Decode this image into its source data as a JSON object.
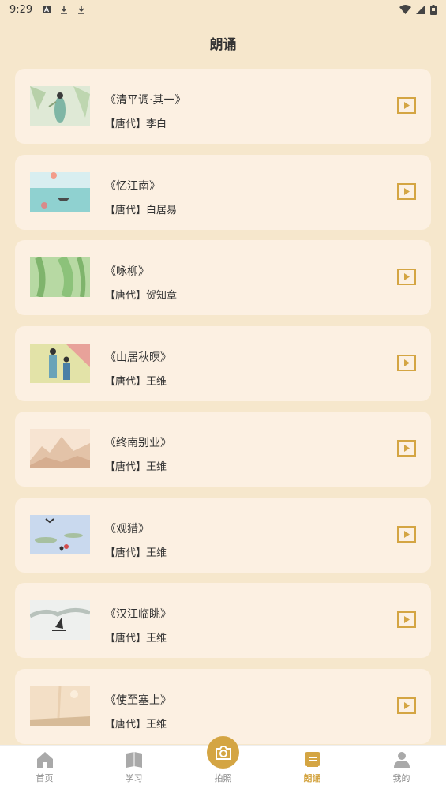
{
  "status_bar": {
    "time": "9:29",
    "icons": [
      "a-icon",
      "download-icon",
      "download-icon"
    ],
    "right_icons": [
      "wifi-icon",
      "signal-icon",
      "battery-icon"
    ]
  },
  "header": {
    "title": "朗诵"
  },
  "poems": [
    {
      "title": "《清平调·其一》",
      "author": "【唐代】李白",
      "thumb": "lady-painting"
    },
    {
      "title": "《忆江南》",
      "author": "【唐代】白居易",
      "thumb": "river-boat-painting"
    },
    {
      "title": "《咏柳》",
      "author": "【唐代】贺知章",
      "thumb": "willow-painting"
    },
    {
      "title": "《山居秋暝》",
      "author": "【唐代】王维",
      "thumb": "figures-painting"
    },
    {
      "title": "《终南别业》",
      "author": "【唐代】王维",
      "thumb": "mountain-painting"
    },
    {
      "title": "《观猎》",
      "author": "【唐代】王维",
      "thumb": "hunting-painting"
    },
    {
      "title": "《汉江临眺》",
      "author": "【唐代】王维",
      "thumb": "ink-boat-painting"
    },
    {
      "title": "《使至塞上》",
      "author": "【唐代】王维",
      "thumb": "desert-painting"
    }
  ],
  "tabs": [
    {
      "label": "首页",
      "icon": "home-icon"
    },
    {
      "label": "学习",
      "icon": "book-icon"
    },
    {
      "label": "拍照",
      "icon": "camera-icon"
    },
    {
      "label": "朗诵",
      "icon": "recite-icon",
      "active": true
    },
    {
      "label": "我的",
      "icon": "profile-icon"
    }
  ],
  "colors": {
    "background": "#f6e7cc",
    "card": "#fcf0e2",
    "accent": "#d4a543"
  }
}
